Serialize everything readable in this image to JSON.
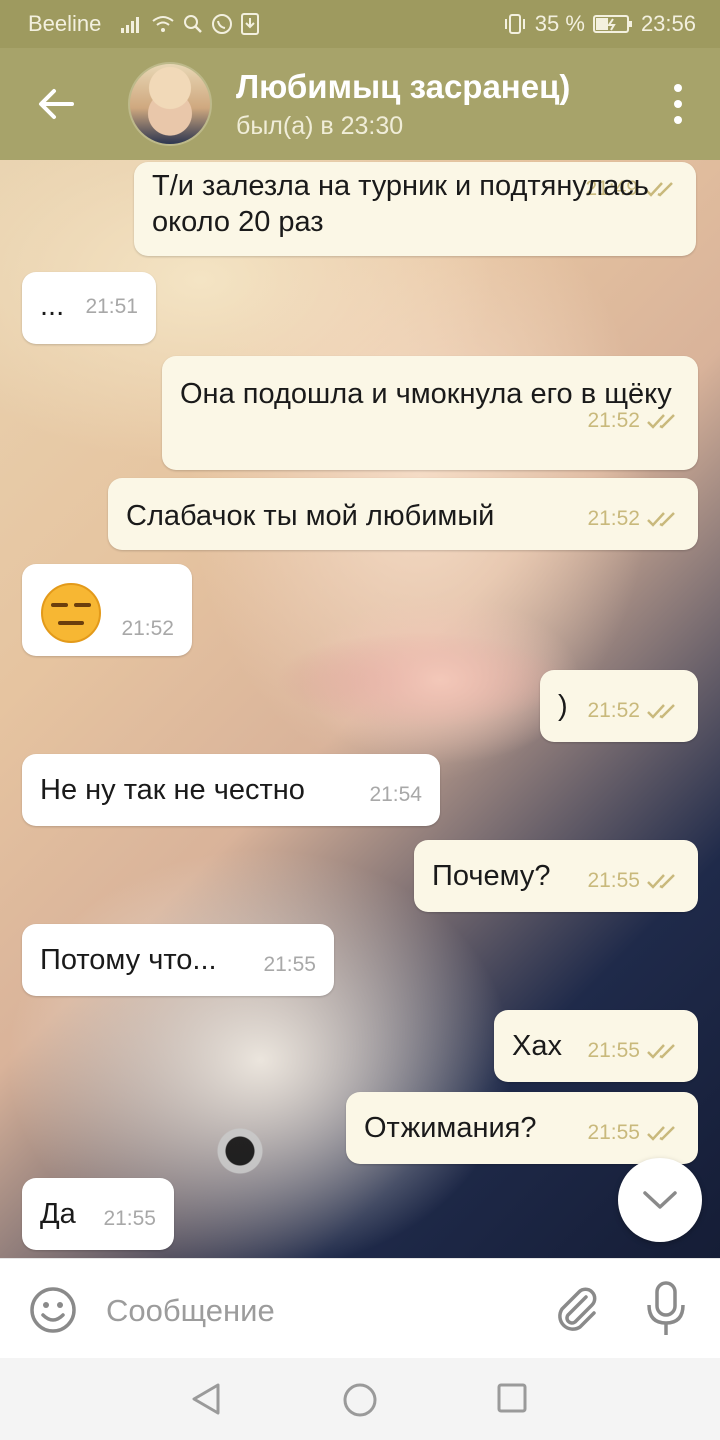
{
  "status_bar": {
    "carrier": "Beeline",
    "battery": "35 %",
    "time": "23:56"
  },
  "header": {
    "title": "Любимыц засранец)",
    "subtitle": "был(а) в 23:30"
  },
  "messages": [
    {
      "dir": "out",
      "text": "Т/и залезла на турник и подтянулась около 20 раз",
      "time": "21:49"
    },
    {
      "dir": "in",
      "text": "...",
      "time": "21:51"
    },
    {
      "dir": "out",
      "text": "Она подошла и чмокнула его в щёку",
      "time": "21:52"
    },
    {
      "dir": "out",
      "text": "Слабачок ты мой любимый",
      "time": "21:52"
    },
    {
      "dir": "in",
      "text": "",
      "emoji": "expressionless-face",
      "time": "21:52"
    },
    {
      "dir": "out",
      "text": ")",
      "time": "21:52"
    },
    {
      "dir": "in",
      "text": "Не ну так не честно",
      "time": "21:54"
    },
    {
      "dir": "out",
      "text": "Почему?",
      "time": "21:55"
    },
    {
      "dir": "in",
      "text": "Потому что...",
      "time": "21:55"
    },
    {
      "dir": "out",
      "text": "Хах",
      "time": "21:55"
    },
    {
      "dir": "out",
      "text": "Отжимания?",
      "time": "21:55"
    },
    {
      "dir": "in",
      "text": "Да",
      "time": "21:55"
    }
  ],
  "input": {
    "placeholder": "Сообщение"
  },
  "colors": {
    "header": "#a7a36a",
    "status_bar": "#9e9a5f",
    "outgoing_bubble": "#fbf7e6",
    "incoming_bubble": "#ffffff",
    "check_marks": "#c9b97c"
  }
}
